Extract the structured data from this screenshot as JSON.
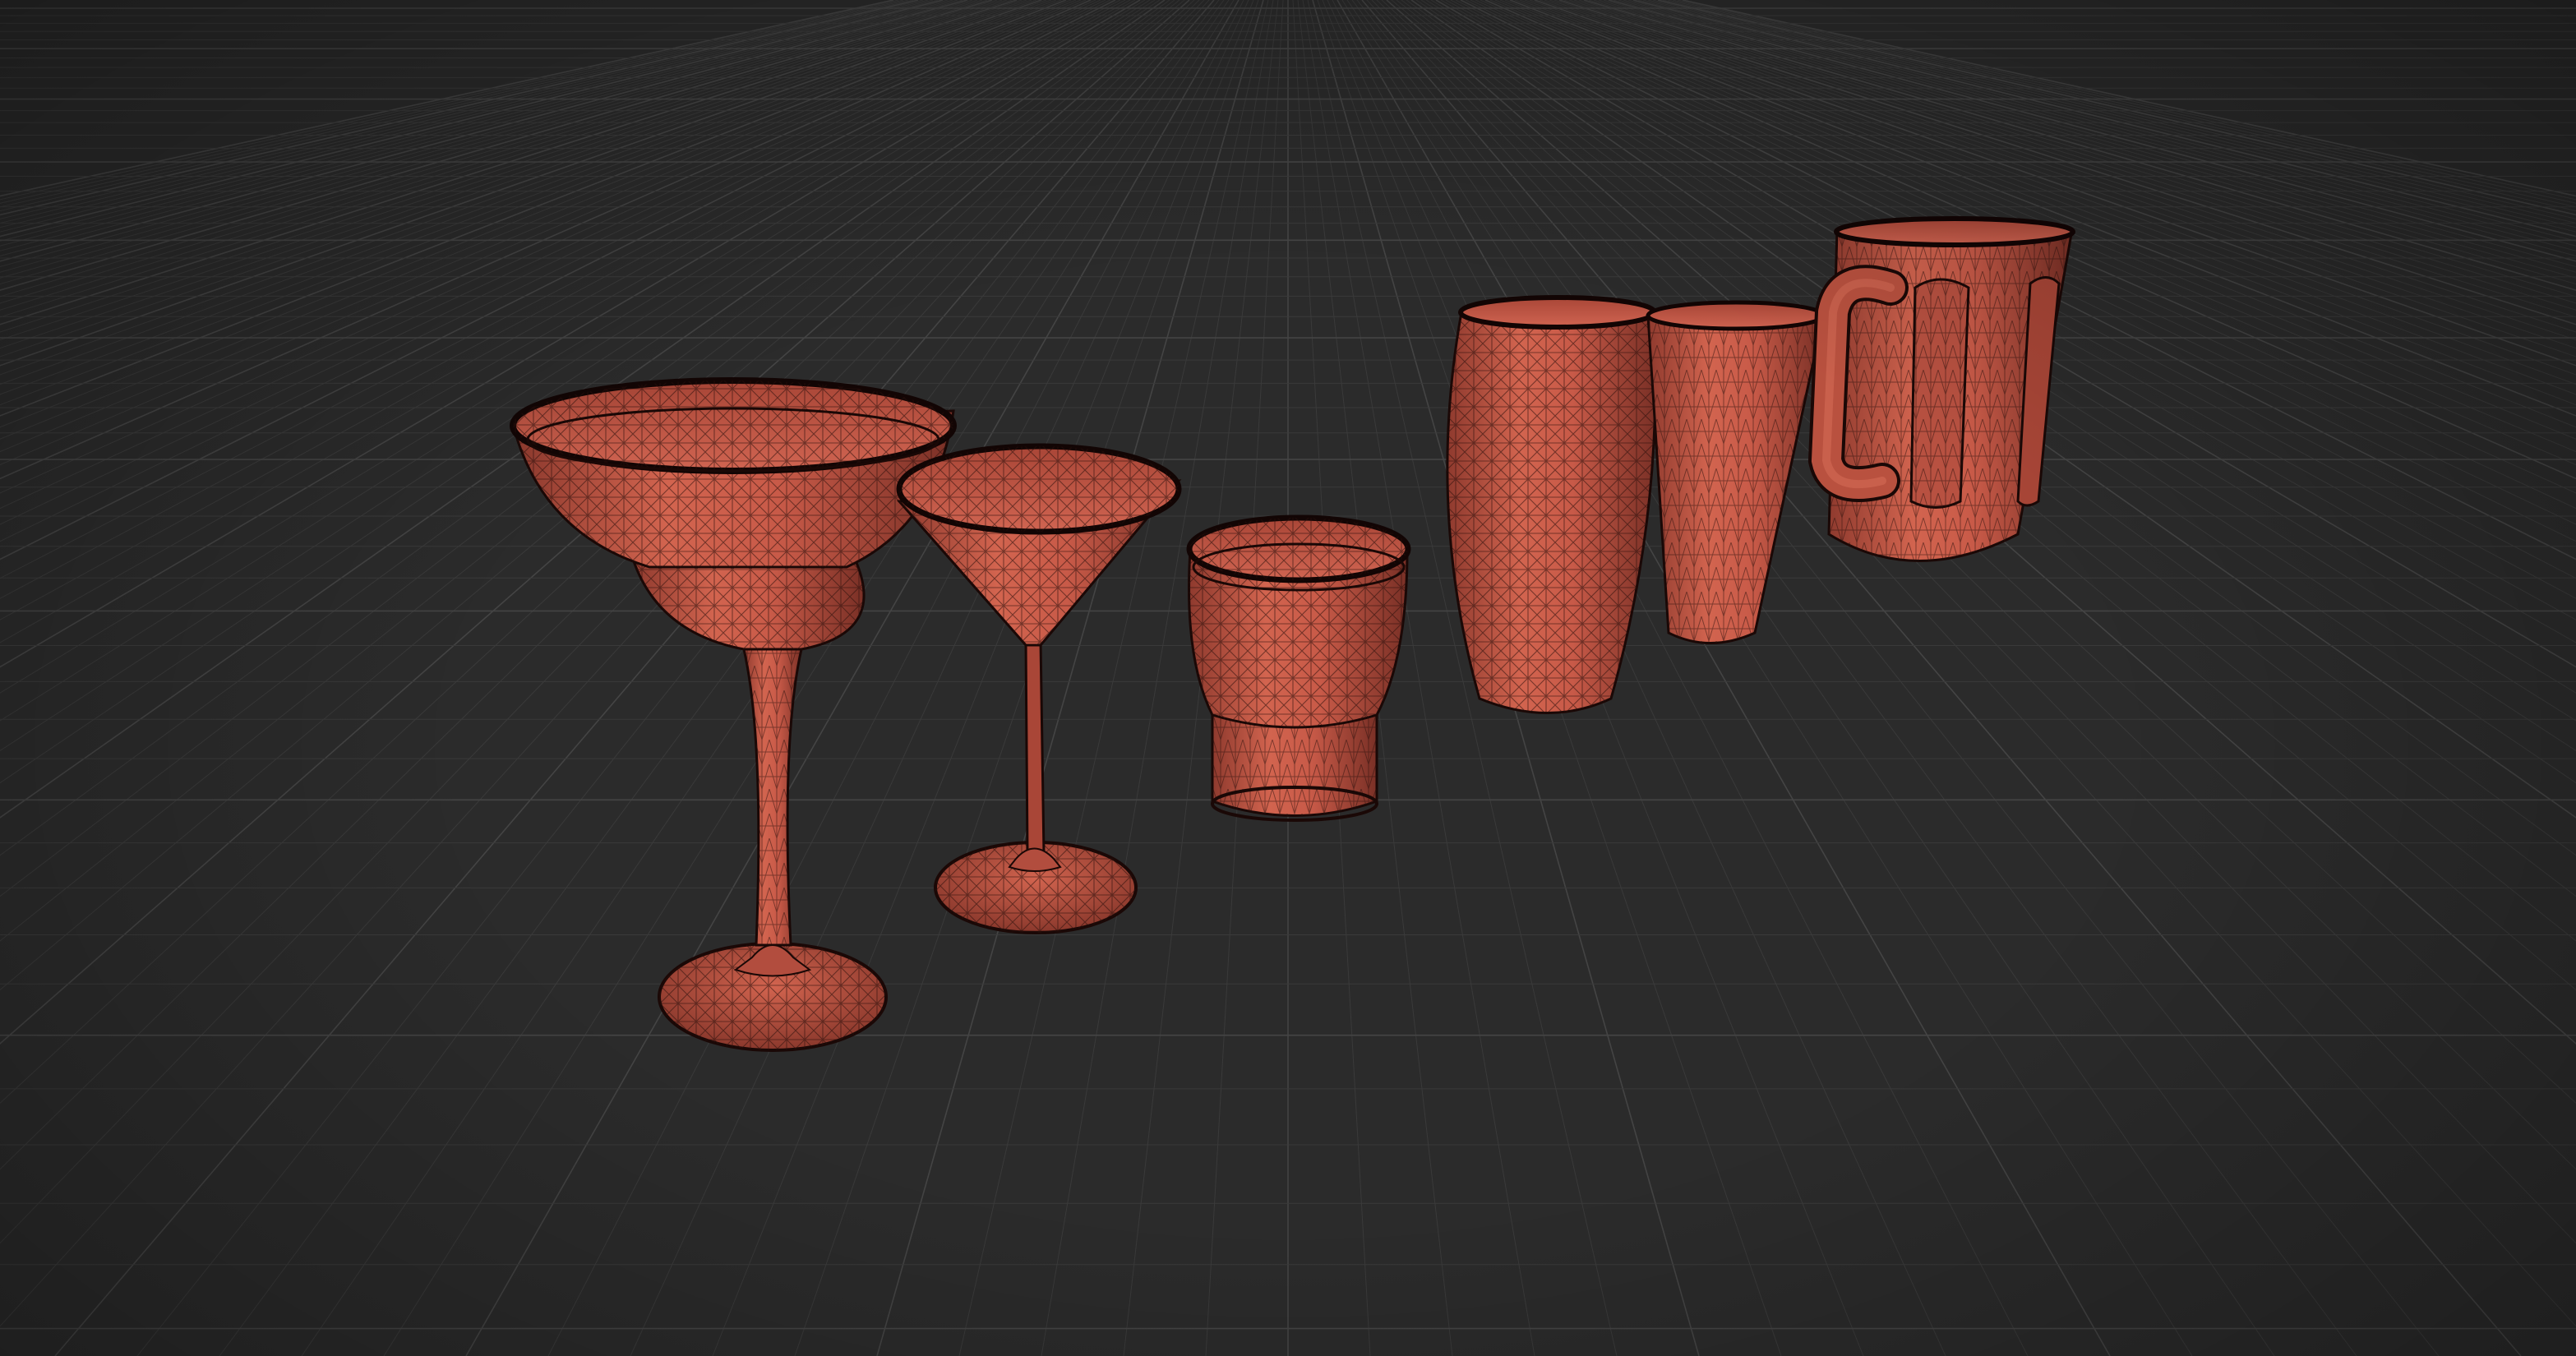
{
  "viewport": {
    "background": "#2b2b2b",
    "grid_color": "#3a3a3a",
    "grid_major_color": "#444444",
    "view_mode": "wireframe-on-shaded"
  },
  "material": {
    "base_color": "#c0594a",
    "shadow_color": "#7a3026",
    "highlight_color": "#e07a66",
    "wire_color": "#2a0f0b"
  },
  "objects": [
    {
      "id": "margarita-glass",
      "icon": "margarita-glass-icon"
    },
    {
      "id": "martini-glass",
      "icon": "martini-glass-icon"
    },
    {
      "id": "rocks-glass",
      "icon": "rocks-glass-icon"
    },
    {
      "id": "barrel-glass",
      "icon": "barrel-glass-icon"
    },
    {
      "id": "pint-glass",
      "icon": "pint-glass-icon"
    },
    {
      "id": "beer-mug",
      "icon": "beer-mug-icon"
    }
  ]
}
